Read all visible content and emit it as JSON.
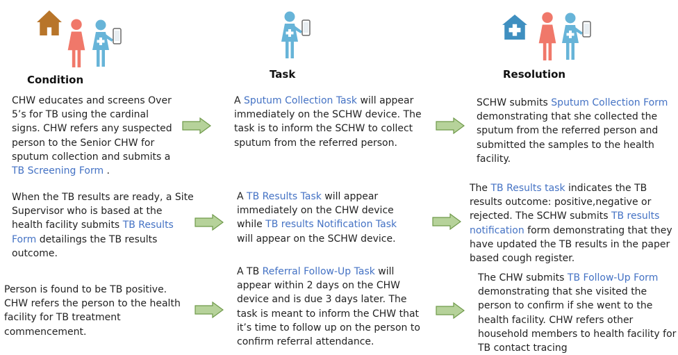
{
  "colors": {
    "link": "#4472c4",
    "house": "#b8752a",
    "clinic": "#3f8fc0",
    "woman": "#f0786a",
    "nurse": "#67b4d8",
    "arrow_fill": "#b6d29a",
    "arrow_stroke": "#6f9a4a"
  },
  "icons": {
    "condition": [
      "house-icon",
      "woman-icon",
      "nurse-icon"
    ],
    "task": [
      "nurse-icon"
    ],
    "resolution": [
      "clinic-icon",
      "woman-icon",
      "nurse-icon"
    ]
  },
  "headers": {
    "condition": "Condition",
    "task": "Task",
    "resolution": "Resolution"
  },
  "rows": [
    {
      "condition": {
        "text": "CHW educates and screens Over 5’s for TB using the cardinal signs. CHW refers any suspected person to the Senior CHW for sputum collection and submits a ",
        "link": "TB Screening Form",
        "after": " ."
      },
      "task": {
        "t1": "A ",
        "l1": "Sputum Collection Task",
        "t2": " will appear immediately on the SCHW device. The task is to inform the SCHW to collect sputum from the referred person."
      },
      "resolution": {
        "t1": "SCHW submits ",
        "l1": "Sputum Collection Form",
        "t2": " demonstrating  that she collected the sputum from the referred person and submitted the samples to the health facility."
      }
    },
    {
      "condition": {
        "t1": "When the TB results are ready, a Site Supervisor who is based at the health facility submits ",
        "l1": "TB Results Form",
        "t2": " detailings the TB results outcome."
      },
      "task": {
        "t1": "A ",
        "l1": "TB Results Task",
        "t2": " will appear immediately on the CHW device while ",
        "l2": "TB results Notification Task",
        "t3": " will appear on the SCHW device."
      },
      "resolution": {
        "t1": "The ",
        "l1": "TB Results task",
        "t2": " indicates the TB results outcome: positive,negative or rejected. The SCHW submits ",
        "l2": "TB results notification",
        "t3": " form demonstrating that they have updated the TB results in the paper based cough register."
      }
    },
    {
      "condition": {
        "text": "Person is found to be TB positive. CHW refers the person to the health facility for TB treatment commencement."
      },
      "task": {
        "t1": "A TB ",
        "l1": "Referral Follow-Up Task",
        "t2": " will appear within 2 days on the CHW device and is due 3  days later. The task is meant to inform the CHW that it’s time to follow up on the person to confirm referral attendance."
      },
      "resolution": {
        "t1": "The CHW submits ",
        "l1": "TB Follow-Up Form",
        "t2": " demonstrating that she visited the person to confirm if she went to the health facility. CHW refers other household members to health facility for TB contact tracing"
      }
    }
  ]
}
